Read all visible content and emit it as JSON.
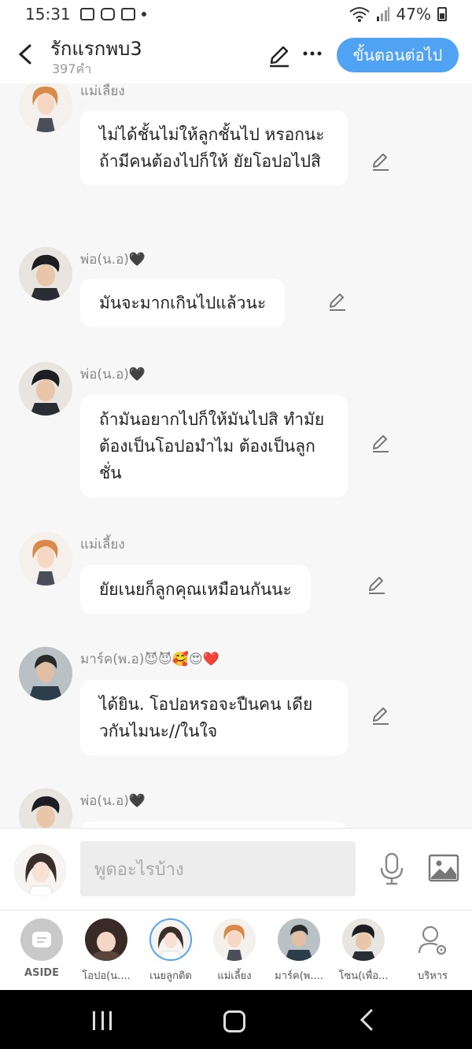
{
  "status": {
    "time": "15:31",
    "battery": "47%"
  },
  "header": {
    "title": "รักแรกพบ3",
    "word_count": "397คำ",
    "next_button": "ขั้นตอนต่อไป"
  },
  "messages": [
    {
      "sender": "แม่เลี้ยง",
      "text": "ไม่ได้ชั้นไม่ให้ลูกชั้นไป หรอกนะถ้ามีคนต้องไปก็ให้ ยัยโอปอไปสิ",
      "avatar": "woman-orange-hair"
    },
    {
      "sender": "พ่อ(น.อ)🖤",
      "text": "มันจะมากเกินไปแล้วนะ",
      "avatar": "man-dark-hair"
    },
    {
      "sender": "พ่อ(น.อ)🖤",
      "text": "ถ้ามันอยากไปก็ให้มันไปสิ ทำมัยต้องเป็นโอปอมำไม ต้องเป็นลูกชั่น",
      "avatar": "man-dark-hair"
    },
    {
      "sender": "แม่เลี้ยง",
      "text": "ยัยเนยก็ลูกคุณเหมือนกันนะ",
      "avatar": "woman-orange-hair"
    },
    {
      "sender": "มาร์ค(พ.อ)😈😈🥰😍❤️",
      "text": "ได้ยิน. โอปอหรอจะปืนคน เดียวกันไมนะ//ในใจ",
      "avatar": "man-suit"
    },
    {
      "sender": "พ่อ(น.อ)🖤",
      "text": "",
      "avatar": "man-dark-hair"
    }
  ],
  "input": {
    "placeholder": "พูดอะไรบ้าง"
  },
  "characters": [
    {
      "label": "ASIDE"
    },
    {
      "label": "โอปอ(น...."
    },
    {
      "label": "เนยลูกติด"
    },
    {
      "label": "แม่เลี้ยง"
    },
    {
      "label": "มาร์ค(พ...."
    },
    {
      "label": "โซน(เพื่อ..."
    },
    {
      "label": "บริหาร"
    }
  ],
  "colors": {
    "accent": "#4fa3f2",
    "background": "#f7f7f7",
    "bubble": "#ffffff"
  }
}
